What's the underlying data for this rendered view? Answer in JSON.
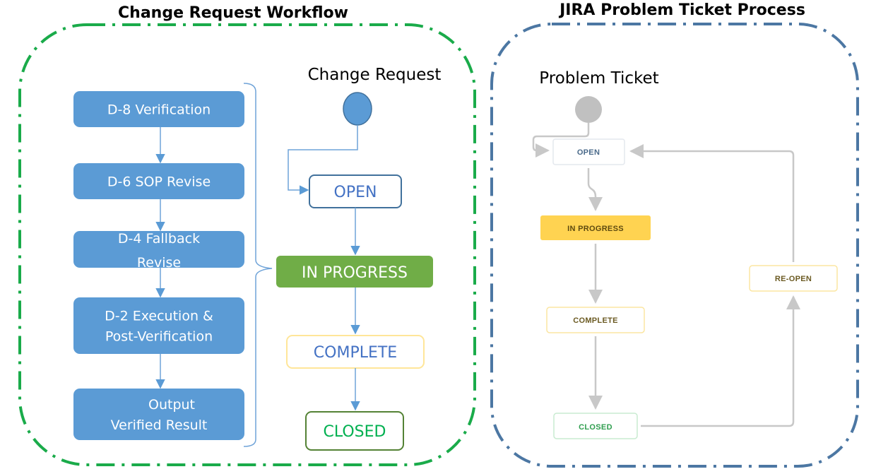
{
  "colors": {
    "cr_border": "#1aab4a",
    "jira_border": "#4c77a3",
    "step_fill": "#5b9bd5",
    "connector_blue": "#6fa3d8",
    "open_border": "#41719c",
    "open_text": "#4472c4",
    "inprogress_fill": "#70ad47",
    "complete_border": "#ffe699",
    "complete_text": "#4472c4",
    "closed_border": "#548235",
    "closed_text": "#00b050",
    "start_circle": "#5b9bd5",
    "jira_arrow": "#c8c8c8",
    "jira_start": "#c0c0c0",
    "jira_open_text": "#4a6a8a",
    "jira_open_border": "#e4e8ee",
    "jira_inprogress_fill": "#ffd351",
    "jira_inprogress_text": "#5e4a10",
    "jira_yellow_border": "#fbe6a2",
    "jira_yellow_text": "#6b5a22",
    "jira_closed_border": "#c9ebd1",
    "jira_closed_text": "#2f9e4f"
  },
  "change_request_panel": {
    "title": "Change Request Workflow",
    "subtitle": "Change Request",
    "steps": [
      {
        "lines": [
          "D-8 Verification"
        ]
      },
      {
        "lines": [
          "D-6 SOP Revise"
        ]
      },
      {
        "lines": [
          "D-4 Fallback",
          "Revise"
        ]
      },
      {
        "lines": [
          "D-2 Execution &",
          "Post-Verification"
        ]
      },
      {
        "lines": [
          "Output",
          "Verified Result"
        ]
      }
    ],
    "states": {
      "open": "OPEN",
      "in_progress": "IN PROGRESS",
      "complete": "COMPLETE",
      "closed": "CLOSED"
    }
  },
  "jira_panel": {
    "title": "JIRA Problem Ticket Process",
    "subtitle": "Problem Ticket",
    "states": {
      "open": "OPEN",
      "in_progress": "IN PROGRESS",
      "complete": "COMPLETE",
      "closed": "CLOSED",
      "reopen": "RE-OPEN"
    }
  }
}
